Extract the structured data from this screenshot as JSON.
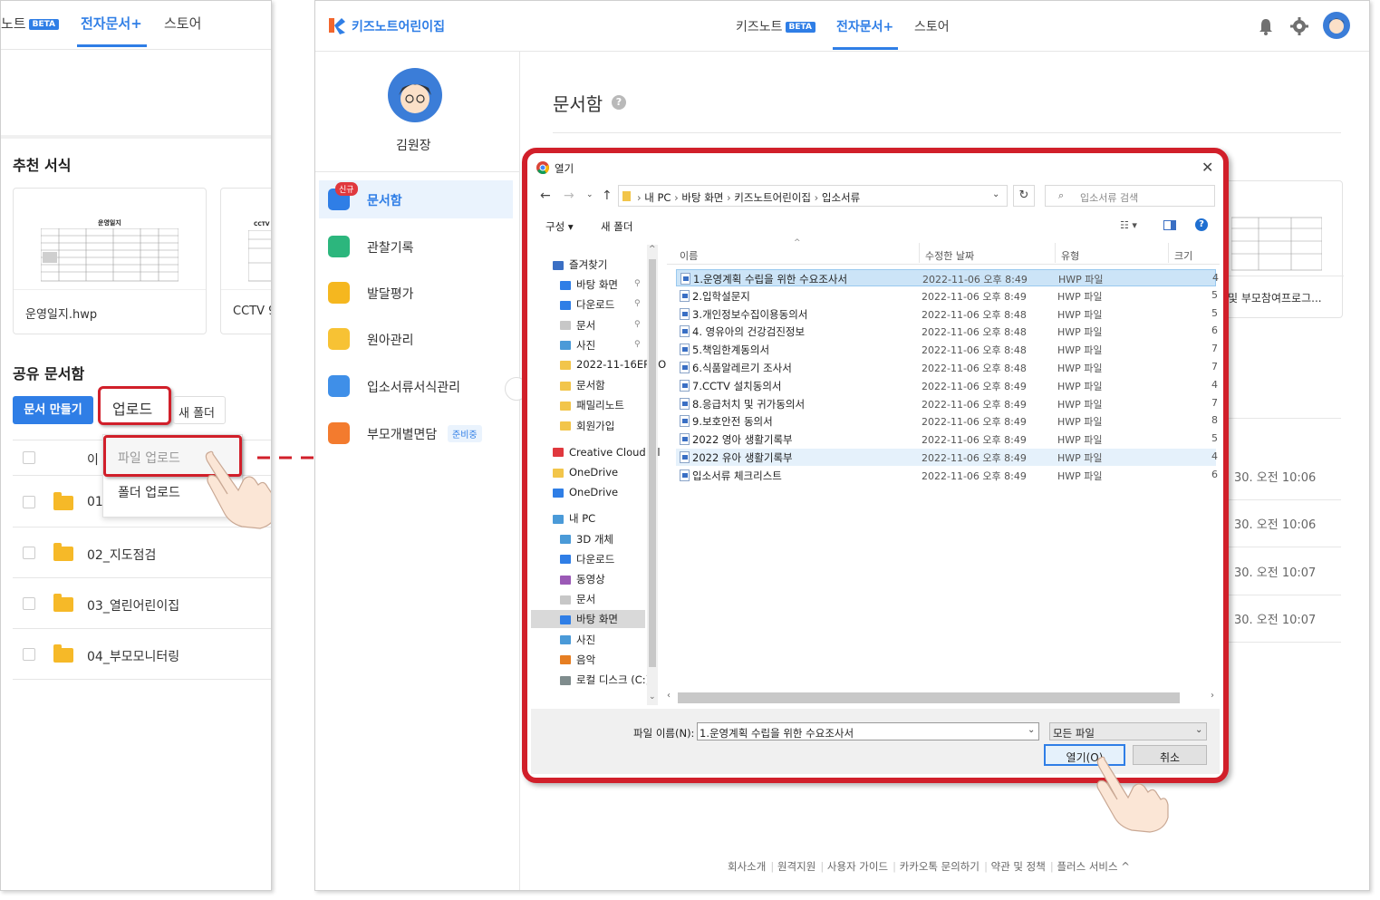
{
  "left": {
    "tabs": [
      {
        "label": "노트",
        "badge": "BETA"
      },
      {
        "label": "전자문서+"
      },
      {
        "label": "스토어"
      }
    ],
    "recommended_title": "추천 서식",
    "templates": [
      {
        "name": "운영일지.hwp",
        "preview_title": "운영일지"
      },
      {
        "name": "CCTV 9",
        "preview_title": "CCTV"
      }
    ],
    "shared_title": "공유 문서함",
    "create_button": "문서 만들기",
    "upload_button": "업로드",
    "new_folder_button": "새 폴더",
    "dropdown": {
      "file_upload": "파일 업로드",
      "folder_upload": "폴더 업로드"
    },
    "rows": [
      {
        "name": "이"
      },
      {
        "name": "01"
      },
      {
        "name": "02_지도점검"
      },
      {
        "name": "03_열린어린이집"
      },
      {
        "name": "04_부모모니터링"
      }
    ]
  },
  "right": {
    "logo_text": "키즈노트어린이집",
    "tabs": [
      {
        "label": "키즈노트",
        "badge": "BETA"
      },
      {
        "label": "전자문서+"
      },
      {
        "label": "스토어"
      }
    ],
    "user_name": "김원장",
    "menu": [
      {
        "label": "문서함",
        "badge": "신규"
      },
      {
        "label": "관찰기록"
      },
      {
        "label": "발달평가"
      },
      {
        "label": "원아관리"
      },
      {
        "label": "입소서류서식관리"
      },
      {
        "label": "부모개별면담",
        "tag": "준비중"
      }
    ],
    "page_title": "문서함",
    "card_caption": "및 부모참여프로그...",
    "dates": [
      "30. 오전 10:06",
      "30. 오전 10:06",
      "30. 오전 10:07",
      "30. 오전 10:07"
    ],
    "footer": [
      "회사소개",
      "원격지원",
      "사용자 가이드",
      "카카오톡 문의하기",
      "약관 및 정책",
      "플러스 서비스 ^"
    ]
  },
  "dialog": {
    "title": "열기",
    "path": [
      "내 PC",
      "바탕 화면",
      "키즈노트어린이집",
      "입소서류"
    ],
    "search_placeholder": "입소서류 검색",
    "organize": "구성 ▾",
    "new_folder": "새 폴더",
    "columns": {
      "name": "이름",
      "date": "수정한 날짜",
      "type": "유형",
      "size": "크기"
    },
    "tree": [
      {
        "label": "즐겨찾기",
        "level": 0,
        "pin": false
      },
      {
        "label": "바탕 화면",
        "level": 1,
        "pin": true
      },
      {
        "label": "다운로드",
        "level": 1,
        "pin": true
      },
      {
        "label": "문서",
        "level": 1,
        "pin": true
      },
      {
        "label": "사진",
        "level": 1,
        "pin": true
      },
      {
        "label": "2022-11-16ERRO",
        "level": 1,
        "pin": false
      },
      {
        "label": "문서함",
        "level": 1,
        "pin": false
      },
      {
        "label": "패밀리노트",
        "level": 1,
        "pin": false
      },
      {
        "label": "회원가입",
        "level": 1,
        "pin": false
      },
      {
        "label": "Creative Cloud Fil",
        "level": 0,
        "pin": false
      },
      {
        "label": "OneDrive",
        "level": 0,
        "pin": false
      },
      {
        "label": "OneDrive",
        "level": 0,
        "pin": false
      },
      {
        "label": "내 PC",
        "level": 0,
        "pin": false
      },
      {
        "label": "3D 개체",
        "level": 1,
        "pin": false
      },
      {
        "label": "다운로드",
        "level": 1,
        "pin": false
      },
      {
        "label": "동영상",
        "level": 1,
        "pin": false
      },
      {
        "label": "문서",
        "level": 1,
        "pin": false
      },
      {
        "label": "바탕 화면",
        "level": 1,
        "pin": false
      },
      {
        "label": "사진",
        "level": 1,
        "pin": false
      },
      {
        "label": "음악",
        "level": 1,
        "pin": false
      },
      {
        "label": "로컬 디스크 (C:)",
        "level": 1,
        "pin": false
      }
    ],
    "files": [
      {
        "name": "1.운영계획 수립을 위한 수요조사서",
        "date": "2022-11-06 오후 8:49",
        "type": "HWP 파일",
        "size": "4"
      },
      {
        "name": "2.입학설문지",
        "date": "2022-11-06 오후 8:49",
        "type": "HWP 파일",
        "size": "5"
      },
      {
        "name": "3.개인정보수집이용동의서",
        "date": "2022-11-06 오후 8:48",
        "type": "HWP 파일",
        "size": "5"
      },
      {
        "name": "4. 영유아의 건강검진정보",
        "date": "2022-11-06 오후 8:48",
        "type": "HWP 파일",
        "size": "6"
      },
      {
        "name": "5.책임한계동의서",
        "date": "2022-11-06 오후 8:48",
        "type": "HWP 파일",
        "size": "7"
      },
      {
        "name": "6.식품알레르기 조사서",
        "date": "2022-11-06 오후 8:48",
        "type": "HWP 파일",
        "size": "7"
      },
      {
        "name": "7.CCTV 설치동의서",
        "date": "2022-11-06 오후 8:49",
        "type": "HWP 파일",
        "size": "4"
      },
      {
        "name": "8.응급처치 및 귀가동의서",
        "date": "2022-11-06 오후 8:49",
        "type": "HWP 파일",
        "size": "7"
      },
      {
        "name": "9.보호안전 동의서",
        "date": "2022-11-06 오후 8:49",
        "type": "HWP 파일",
        "size": "8"
      },
      {
        "name": "2022 영아 생활기록부",
        "date": "2022-11-06 오후 8:49",
        "type": "HWP 파일",
        "size": "5"
      },
      {
        "name": "2022 유아 생활기록부",
        "date": "2022-11-06 오후 8:49",
        "type": "HWP 파일",
        "size": "4"
      },
      {
        "name": "입소서류 체크리스트",
        "date": "2022-11-06 오후 8:49",
        "type": "HWP 파일",
        "size": "6"
      }
    ],
    "filename_label": "파일 이름(N):",
    "filename_value": "1.운영계획 수립을 위한 수요조사서",
    "filter_value": "모든 파일",
    "open_button": "열기(O)",
    "cancel_button": "취소"
  },
  "colors": {
    "accent": "#2f7ee6",
    "highlight": "#d11f2a",
    "selected_row": "#cce4f7"
  }
}
